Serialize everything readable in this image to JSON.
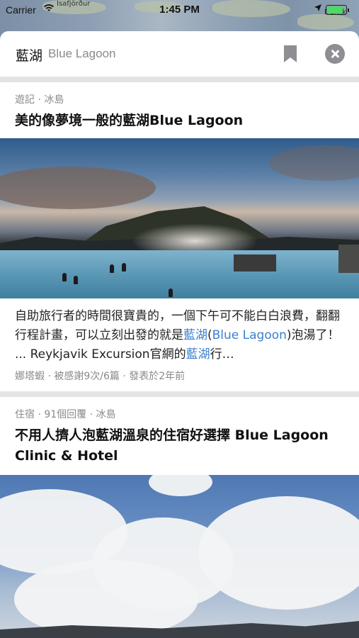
{
  "status_bar": {
    "carrier": "Carrier",
    "time": "1:45 PM",
    "map_label_left": "Ísafjörður",
    "map_label_right": "Dalvík",
    "battery_level": 0.85
  },
  "search": {
    "query": "藍湖",
    "query_sub": "Blue Lagoon"
  },
  "results": [
    {
      "meta": "遊記 · 冰島",
      "title": "美的像夢境一般的藍湖Blue Lagoon",
      "excerpt": {
        "text_1": "自助旅行者的時間很寶貴的，一個下午可不能白白浪費，翻翻行程計畫，可以立刻出發的就是",
        "hl_1": "藍湖",
        "text_2": "(",
        "hl_2": "Blue Lagoon",
        "text_3": ")泡湯了！ ... Reykjavik Excursion官網的",
        "hl_3": "藍湖",
        "text_4": "行…"
      },
      "footer": "娜塔蝦 · 被感謝9次/6篇 · 發表於2年前"
    },
    {
      "meta": "住宿 · 91個回覆 · 冰島",
      "title": "不用人擠人泡藍湖溫泉的住宿好選擇 Blue Lagoon Clinic & Hotel"
    }
  ],
  "colors": {
    "highlight": "#3a7fd0",
    "meta_gray": "#8a8a8a",
    "divider": "#e4e4e6",
    "close_button": "#8e8e93",
    "battery": "#4cd964"
  }
}
